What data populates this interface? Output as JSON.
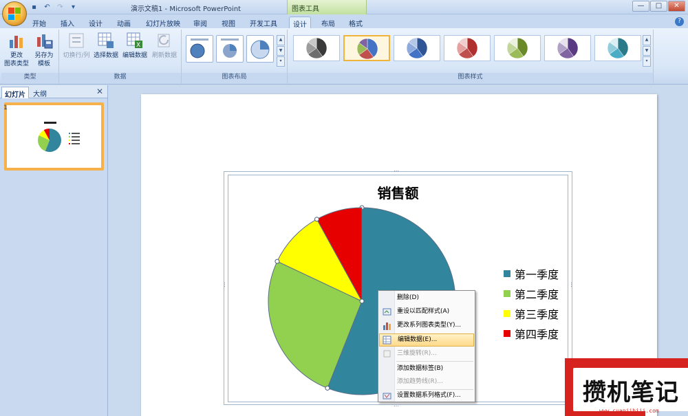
{
  "window": {
    "doc_title": "演示文稿1 - Microsoft PowerPoint",
    "context_title": "图表工具",
    "controls": [
      "—",
      "□",
      "✕"
    ]
  },
  "tabs": [
    {
      "label": "开始"
    },
    {
      "label": "插入"
    },
    {
      "label": "设计"
    },
    {
      "label": "动画"
    },
    {
      "label": "幻灯片放映"
    },
    {
      "label": "审阅"
    },
    {
      "label": "视图"
    },
    {
      "label": "开发工具"
    },
    {
      "label": "设计",
      "active": true
    },
    {
      "label": "布局"
    },
    {
      "label": "格式"
    }
  ],
  "ribbon": {
    "type_group": {
      "label": "类型",
      "change_type": "更改\n图表类型",
      "save_template": "另存为\n模板"
    },
    "data_group": {
      "label": "数据",
      "switch_row_col": "切换行/列",
      "select_data": "选择数据",
      "edit_data": "编辑数据",
      "refresh_data": "刷新数据"
    },
    "layout_group": {
      "label": "图表布局"
    },
    "styles_group": {
      "label": "图表样式"
    }
  },
  "styles": [
    {
      "colors": [
        "#3a3a3a",
        "#6e6e6e",
        "#9c9c9c",
        "#c8c8c8"
      ]
    },
    {
      "colors": [
        "#4472c4",
        "#c0504d",
        "#9bbb59",
        "#8064a2"
      ],
      "selected": true
    },
    {
      "colors": [
        "#2f5597",
        "#4472c4",
        "#8faadc",
        "#b4c7e7"
      ]
    },
    {
      "colors": [
        "#b03030",
        "#c0504d",
        "#e6a0a0",
        "#f2cdcd"
      ]
    },
    {
      "colors": [
        "#6a8a2a",
        "#9bbb59",
        "#c3d69b",
        "#ebf1de"
      ]
    },
    {
      "colors": [
        "#5a3a82",
        "#8064a2",
        "#b2a1c7",
        "#e5e0ec"
      ]
    },
    {
      "colors": [
        "#2a7a8a",
        "#4bacc6",
        "#92cddc",
        "#daeef3"
      ]
    }
  ],
  "panel": {
    "tab_slides": "幻灯片",
    "tab_outline": "大纲",
    "slide_number": "1"
  },
  "chart_data": {
    "type": "pie",
    "title": "销售额",
    "categories": [
      "第一季度",
      "第二季度",
      "第三季度",
      "第四季度"
    ],
    "values": [
      56,
      26,
      10,
      8
    ],
    "colors": [
      "#31859c",
      "#92d050",
      "#ffff00",
      "#e60000"
    ],
    "legend_position": "right"
  },
  "context_menu": {
    "items": [
      {
        "label": "删除(D)",
        "icon": "none"
      },
      {
        "label": "重设以匹配样式(A)",
        "icon": "reset-style-icon"
      },
      {
        "label": "更改系列图表类型(Y)...",
        "icon": "chart-type-icon"
      },
      {
        "label": "编辑数据(E)...",
        "icon": "edit-data-icon",
        "highlight": true
      },
      {
        "label": "三维旋转(R)...",
        "icon": "rotate-3d-icon",
        "disabled": true
      },
      {
        "label": "添加数据标签(B)",
        "icon": "none"
      },
      {
        "label": "添加趋势线(R)...",
        "icon": "none",
        "disabled": true
      },
      {
        "label": "设置数据系列格式(F)...",
        "icon": "format-series-icon"
      }
    ]
  },
  "watermark": {
    "text": "攒机笔记",
    "url": "www.cuanjibiji.com"
  }
}
